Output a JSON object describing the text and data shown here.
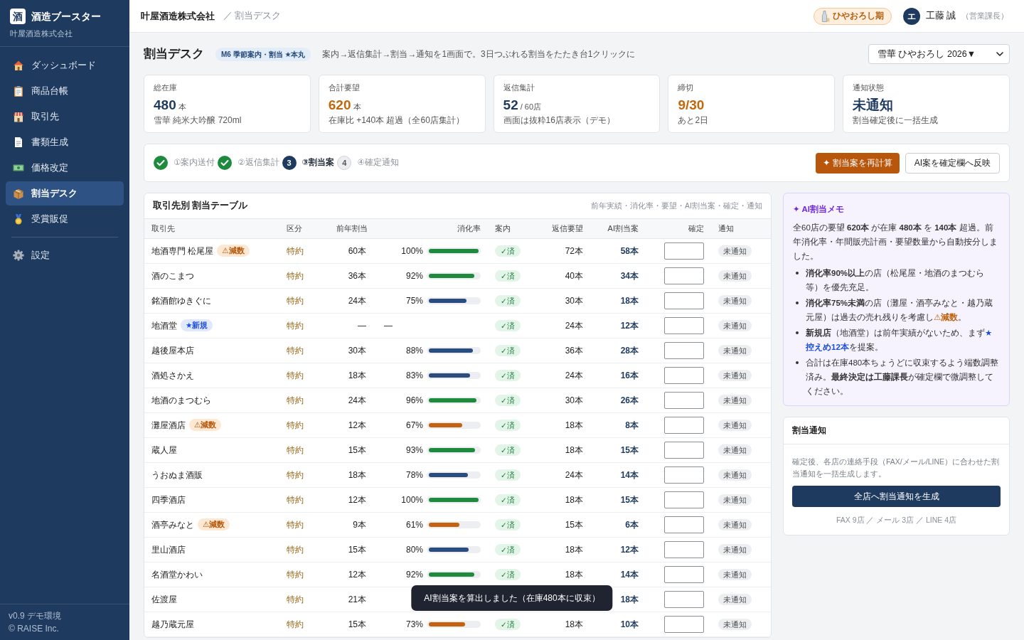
{
  "sidebar": {
    "logo": "酒",
    "app_name": "酒造ブースター",
    "company": "叶屋酒造株式会社",
    "nav": [
      {
        "items": [
          {
            "label": "ダッシュボード",
            "selected": false
          },
          {
            "label": "商品台帳",
            "selected": false
          },
          {
            "label": "取引先",
            "selected": false
          },
          {
            "label": "書類生成",
            "selected": false
          },
          {
            "label": "価格改定",
            "selected": false
          },
          {
            "label": "割当デスク",
            "selected": true
          },
          {
            "label": "受賞販促",
            "selected": false
          }
        ]
      },
      {
        "items": [
          {
            "label": "設定",
            "selected": false
          }
        ]
      }
    ],
    "footer": [
      "v0.9 デモ環境",
      "© RAISE Inc."
    ]
  },
  "header": {
    "company": "叶屋酒造株式会社",
    "breadcrumb": "／ 割当デスク",
    "season_badge": "ひやおろし期",
    "user": {
      "initial": "エ",
      "name": "工藤 誠",
      "role": "（営業課長）"
    }
  },
  "page": {
    "title": "割当デスク",
    "tag": "M6 季節案内・割当 ★本丸",
    "description": "案内→返信集計→割当→通知を1画面で。3日つぶれる割当をたたき台1クリックに",
    "product_select": "雪華 ひやおろし 2026▼"
  },
  "stats": [
    {
      "label": "総在庫",
      "value": "480",
      "unit": "本",
      "note": "雪華 純米大吟醸 720ml",
      "alert": false
    },
    {
      "label": "合計要望",
      "value": "620",
      "unit": "本",
      "note": "在庫比 +140本 超過（全60店集計）",
      "alert": true
    },
    {
      "label": "返信集計",
      "value": "52",
      "unit": "/ 60店",
      "note": "画面は抜粋16店表示（デモ）",
      "alert": false
    },
    {
      "label": "締切",
      "value": "9/30",
      "note": "あと2日",
      "alert": true
    },
    {
      "label": "通知状態",
      "value": "未通知",
      "note": "割当確定後に一括生成",
      "alert": false
    }
  ],
  "steps": [
    {
      "label": "①案内送付",
      "kind": "done"
    },
    {
      "label": "②返信集計",
      "kind": "done"
    },
    {
      "number": "3",
      "label": "③割当案",
      "kind": "current"
    },
    {
      "number": "4",
      "label": "④確定通知",
      "kind": "todo"
    }
  ],
  "actions": [
    {
      "label": "✦ 割当案を再計算",
      "kind": "primary"
    },
    {
      "label": "AI案を確定欄へ反映",
      "kind": "outline"
    }
  ],
  "table": {
    "title": "取引先別 割当テーブル",
    "subtitle": "前年実績・消化率・要望・AI割当案・確定・通知",
    "columns": [
      "取引先",
      "区分",
      "前年割当",
      "消化率",
      "案内",
      "返信要望",
      "AI割当案",
      "確定",
      "通知"
    ],
    "rows": [
      {
        "name": "地酒専門 松尾屋",
        "tag": {
          "kind": "reduce",
          "text": "⚠減数"
        },
        "category": "特約",
        "previous": "60本",
        "rate": "100%",
        "level": 1.0,
        "invite": "✓済",
        "request": "72本",
        "ai": "58本",
        "notice": "未通知"
      },
      {
        "name": "酒のこまつ",
        "category": "特約",
        "previous": "36本",
        "rate": "92%",
        "level": 0.92,
        "invite": "✓済",
        "request": "40本",
        "ai": "34本",
        "notice": "未通知"
      },
      {
        "name": "銘酒館ゆきぐに",
        "category": "特約",
        "previous": "24本",
        "rate": "75%",
        "level": 0.75,
        "invite": "✓済",
        "request": "30本",
        "ai": "18本",
        "notice": "未通知"
      },
      {
        "name": "地酒堂",
        "tag": {
          "kind": "new",
          "text": "★新規"
        },
        "category": "特約",
        "previous": "—",
        "rate": "—",
        "invite": "✓済",
        "request": "24本",
        "ai": "12本",
        "notice": "未通知"
      },
      {
        "name": "越後屋本店",
        "category": "特約",
        "previous": "30本",
        "rate": "88%",
        "level": 0.88,
        "invite": "✓済",
        "request": "36本",
        "ai": "28本",
        "notice": "未通知"
      },
      {
        "name": "酒処さかえ",
        "category": "特約",
        "previous": "18本",
        "rate": "83%",
        "level": 0.83,
        "invite": "✓済",
        "request": "24本",
        "ai": "16本",
        "notice": "未通知"
      },
      {
        "name": "地酒のまつむら",
        "category": "特約",
        "previous": "24本",
        "rate": "96%",
        "level": 0.96,
        "invite": "✓済",
        "request": "30本",
        "ai": "26本",
        "notice": "未通知"
      },
      {
        "name": "灘屋酒店",
        "tag": {
          "kind": "reduce",
          "text": "⚠減数"
        },
        "category": "特約",
        "previous": "12本",
        "rate": "67%",
        "level": 0.67,
        "invite": "✓済",
        "request": "18本",
        "ai": "8本",
        "notice": "未通知"
      },
      {
        "name": "蔵人屋",
        "category": "特約",
        "previous": "15本",
        "rate": "93%",
        "level": 0.93,
        "invite": "✓済",
        "request": "18本",
        "ai": "15本",
        "notice": "未通知"
      },
      {
        "name": "うおぬま酒販",
        "category": "特約",
        "previous": "18本",
        "rate": "78%",
        "level": 0.78,
        "invite": "✓済",
        "request": "24本",
        "ai": "14本",
        "notice": "未通知"
      },
      {
        "name": "四季酒店",
        "category": "特約",
        "previous": "12本",
        "rate": "100%",
        "level": 1.0,
        "invite": "✓済",
        "request": "18本",
        "ai": "15本",
        "notice": "未通知"
      },
      {
        "name": "酒亭みなと",
        "tag": {
          "kind": "reduce",
          "text": "⚠減数"
        },
        "category": "特約",
        "previous": "9本",
        "rate": "61%",
        "level": 0.61,
        "invite": "✓済",
        "request": "15本",
        "ai": "6本",
        "notice": "未通知"
      },
      {
        "name": "里山酒店",
        "category": "特約",
        "previous": "15本",
        "rate": "80%",
        "level": 0.8,
        "invite": "✓済",
        "request": "18本",
        "ai": "12本",
        "notice": "未通知"
      },
      {
        "name": "名酒堂かわい",
        "category": "特約",
        "previous": "12本",
        "rate": "92%",
        "level": 0.92,
        "invite": "✓済",
        "request": "18本",
        "ai": "14本",
        "notice": "未通知"
      },
      {
        "name": "佐渡屋",
        "category": "特約",
        "previous": "21本",
        "ai": "18本",
        "notice": "未通知"
      },
      {
        "name": "越乃蔵元屋",
        "category": "特約",
        "previous": "15本",
        "rate": "73%",
        "level": 0.73,
        "invite": "✓済",
        "request": "18本",
        "ai": "10本",
        "notice": "未通知"
      }
    ]
  },
  "ai_memo": {
    "title": "✦ AI割当メモ",
    "summary": "全60店の要望 **620本** が在庫 **480本** を **140本** 超過。前年消化率・年間販売計画・要望数量から自動按分しました。",
    "bullets": [
      [
        {
          "text": "消化率90%以上",
          "kind": "bold"
        },
        {
          "text": "の店（松尾屋・地酒のまつむら等）を優先充足。",
          "kind": "normal"
        }
      ],
      [
        {
          "text": "消化率75%未満",
          "kind": "bold"
        },
        {
          "text": "の店（灘屋・酒亭みなと・越乃蔵元屋）は過去の売れ残りを考慮し",
          "kind": "normal"
        },
        {
          "text": "⚠減数",
          "kind": "warn"
        },
        {
          "text": "。",
          "kind": "normal"
        }
      ],
      [
        {
          "text": "新規店",
          "kind": "bold"
        },
        {
          "text": "（地酒堂）は前年実績がないため、まず",
          "kind": "normal"
        },
        {
          "text": "★控えめ12本",
          "kind": "accent"
        },
        {
          "text": "を提案。",
          "kind": "normal"
        }
      ],
      [
        {
          "text": "合計は在庫480本ちょうどに収束するよう端数調整済み。",
          "kind": "normal"
        },
        {
          "text": "最終決定は工藤課長",
          "kind": "bold"
        },
        {
          "text": "が確定欄で微調整してください。",
          "kind": "normal"
        }
      ]
    ]
  },
  "notice_card": {
    "title": "割当通知",
    "text": "確定後、各店の連絡手段（FAX/メール/LINE）に合わせた割当通知を一括生成します。",
    "button": "全店へ割当通知を生成",
    "breakdown": "FAX 9店 ／ メール 3店 ／ LINE 4店"
  },
  "toast": "AI割当案を算出しました（在庫480本に収束）"
}
